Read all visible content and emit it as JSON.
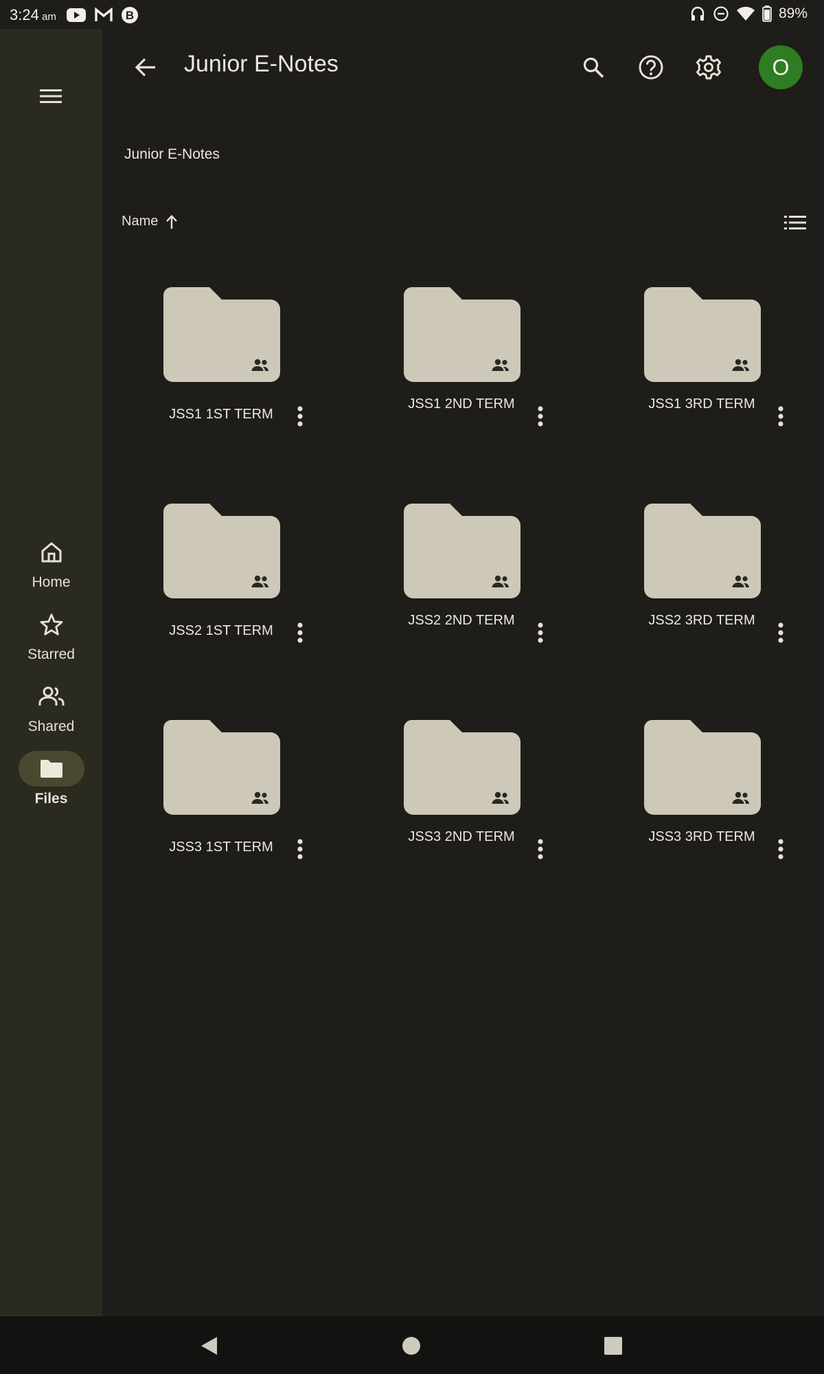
{
  "status": {
    "time": "3:24",
    "ampm": "am",
    "battery": "89%"
  },
  "app": {
    "title": "Junior E-Notes",
    "breadcrumb": "Junior E-Notes",
    "avatar_letter": "O",
    "sort_label": "Name"
  },
  "nav": {
    "items": [
      {
        "label": "Home",
        "icon": "home-icon"
      },
      {
        "label": "Starred",
        "icon": "star-icon"
      },
      {
        "label": "Shared",
        "icon": "people-icon"
      },
      {
        "label": "Files",
        "icon": "folder-icon"
      }
    ],
    "active": "Files"
  },
  "folders": [
    {
      "name": "JSS1 1ST TERM",
      "shared": true
    },
    {
      "name": "JSS1 2ND TERM",
      "shared": true
    },
    {
      "name": "JSS1 3RD TERM",
      "shared": true
    },
    {
      "name": "JSS2 1ST TERM",
      "shared": true
    },
    {
      "name": "JSS2 2ND TERM",
      "shared": true
    },
    {
      "name": "JSS2 3RD TERM",
      "shared": true
    },
    {
      "name": "JSS3 1ST TERM",
      "shared": true
    },
    {
      "name": "JSS3 2ND TERM",
      "shared": true
    },
    {
      "name": "JSS3 3RD TERM",
      "shared": true
    }
  ],
  "colors": {
    "background": "#1e1d19",
    "rail": "#2b2a20",
    "folder": "#cdc8b8",
    "avatar": "#2f7d22"
  }
}
